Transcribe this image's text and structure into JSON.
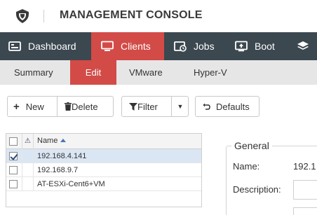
{
  "header": {
    "logo_icon": "shield-logo-icon",
    "title": "MANAGEMENT CONSOLE"
  },
  "main_nav": {
    "items": [
      {
        "label": "Dashboard",
        "icon": "dashboard-icon"
      },
      {
        "label": "Clients",
        "icon": "monitor-icon",
        "active": true
      },
      {
        "label": "Jobs",
        "icon": "jobs-icon"
      },
      {
        "label": "Boot",
        "icon": "boot-icon"
      },
      {
        "label": "",
        "icon": "layers-icon"
      }
    ],
    "active_color": "#d24b47",
    "bg_color": "#3c4850"
  },
  "sub_nav": {
    "items": [
      {
        "label": "Summary"
      },
      {
        "label": "Edit",
        "active": true
      },
      {
        "label": "VMware"
      },
      {
        "label": "Hyper-V"
      }
    ]
  },
  "toolbar": {
    "new_label": "New",
    "delete_label": "Delete",
    "filter_label": "Filter",
    "defaults_label": "Defaults"
  },
  "grid": {
    "columns": [
      "Name"
    ],
    "sort": "ascending",
    "rows": [
      {
        "name": "192.168.4.141",
        "checked": true,
        "selected": true
      },
      {
        "name": "192.168.9.7",
        "checked": false,
        "selected": false
      },
      {
        "name": "AT-ESXi-Cent6+VM",
        "checked": false,
        "selected": false
      }
    ]
  },
  "general": {
    "legend": "General",
    "name_label": "Name:",
    "name_value": "192.1",
    "description_label": "Description:"
  }
}
